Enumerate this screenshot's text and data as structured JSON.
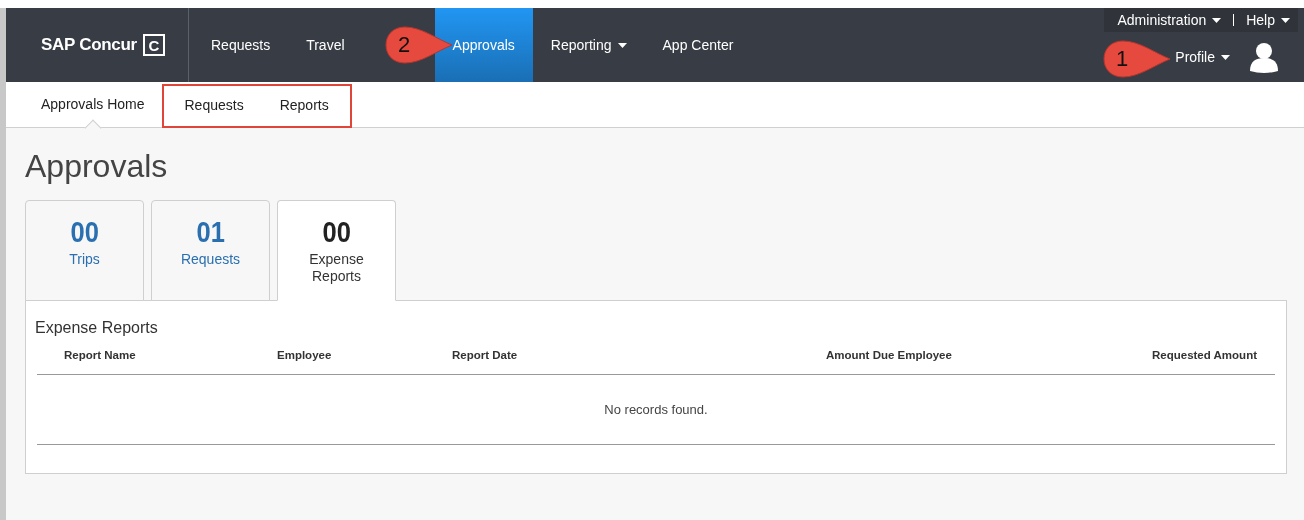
{
  "logo": {
    "text": "SAP Concur",
    "mark": "C"
  },
  "nav": [
    {
      "label": "Requests",
      "selected": false,
      "dropdown": false
    },
    {
      "label": "Travel",
      "selected": false,
      "dropdown": false
    },
    {
      "label": "Approvals",
      "selected": true,
      "dropdown": false
    },
    {
      "label": "Reporting",
      "selected": false,
      "dropdown": true
    },
    {
      "label": "App Center",
      "selected": false,
      "dropdown": false
    }
  ],
  "utility": [
    {
      "label": "Administration"
    },
    {
      "label": "Help"
    }
  ],
  "profile": {
    "label": "Profile"
  },
  "callouts": [
    {
      "number": "2"
    },
    {
      "number": "1"
    }
  ],
  "subnav": [
    {
      "label": "Approvals Home",
      "selected": true,
      "highlighted": false
    },
    {
      "label": "Requests",
      "selected": false,
      "highlighted": true
    },
    {
      "label": "Reports",
      "selected": false,
      "highlighted": true
    }
  ],
  "page_title": "Approvals",
  "tabs": [
    {
      "count": "00",
      "label": "Trips",
      "selected": false
    },
    {
      "count": "01",
      "label": "Requests",
      "selected": false
    },
    {
      "count": "00",
      "label": "Expense Reports",
      "selected": true
    }
  ],
  "panel": {
    "title": "Expense Reports",
    "columns": [
      {
        "label": "Report Name"
      },
      {
        "label": "Employee"
      },
      {
        "label": "Report Date"
      },
      {
        "label": "Amount Due Employee"
      },
      {
        "label": "Requested Amount"
      }
    ],
    "empty_message": "No records found."
  }
}
